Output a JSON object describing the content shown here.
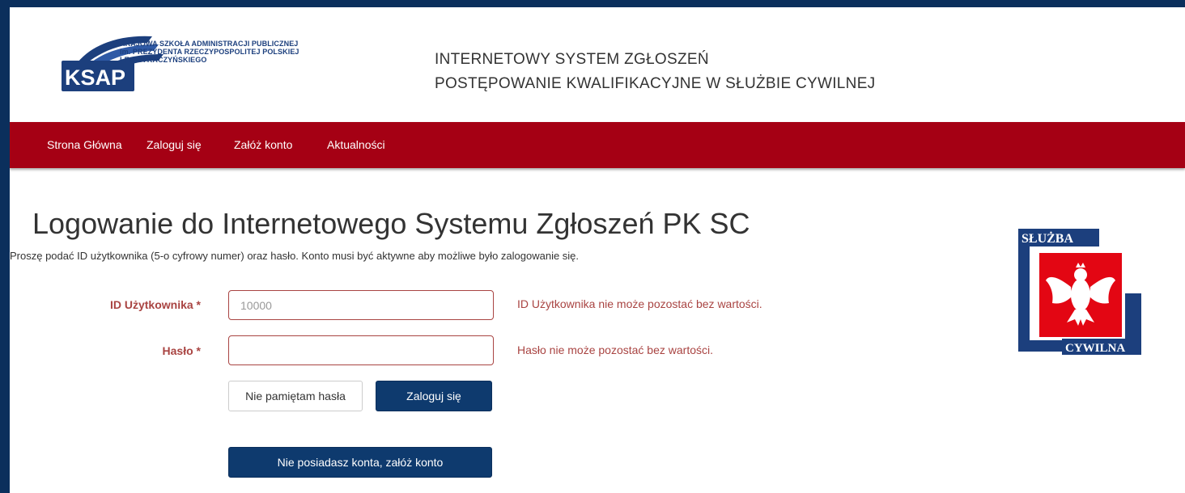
{
  "header": {
    "logo_abbr": "KSAP",
    "logo_lines": [
      "KRAJOWA SZKOŁA ADMINISTRACJI PUBLICZNEJ",
      "im. PREZYDENTA RZECZYPOSPOLITEJ POLSKIEJ",
      "LECHA KACZYŃSKIEGO"
    ],
    "system_title_line1": "INTERNETOWY SYSTEM ZGŁOSZEŃ",
    "system_title_line2": "POSTĘPOWANIE KWALIFIKACYJNE W SŁUŻBIE CYWILNEJ"
  },
  "nav": {
    "items": [
      {
        "label": "Strona Główna"
      },
      {
        "label": "Zaloguj się"
      },
      {
        "label": "Załóż konto"
      },
      {
        "label": "Aktualności"
      }
    ]
  },
  "main": {
    "title": "Logowanie do Internetowego Systemu Zgłoszeń PK SC",
    "instructions": "Proszę podać ID użytkownika (5-o cyfrowy numer) oraz hasło. Konto musi być aktywne aby możliwe było zalogowanie się.",
    "form": {
      "user_id": {
        "label": "ID Użytkownika *",
        "value": "",
        "placeholder": "10000",
        "error": "ID Użytkownika nie może pozostać bez wartości."
      },
      "password": {
        "label": "Hasło *",
        "value": "",
        "placeholder": "",
        "error": "Hasło nie może pozostać bez wartości."
      },
      "forgot_button": "Nie pamiętam hasła",
      "login_button": "Zaloguj się",
      "register_button": "Nie posiadasz konta, załóż konto"
    }
  },
  "badge": {
    "top_text": "SŁUŻBA",
    "bottom_text": "CYWILNA"
  },
  "colors": {
    "page_frame": "#0b2f5c",
    "nav_background": "#a50014",
    "error": "#a94442",
    "primary_button": "#0e3a6e",
    "logo_blue": "#1c3f7d"
  },
  "icons": {
    "ksap_logo": "ksap-logo-icon",
    "sluzba_cywilna_emblem": "polish-eagle-icon"
  }
}
